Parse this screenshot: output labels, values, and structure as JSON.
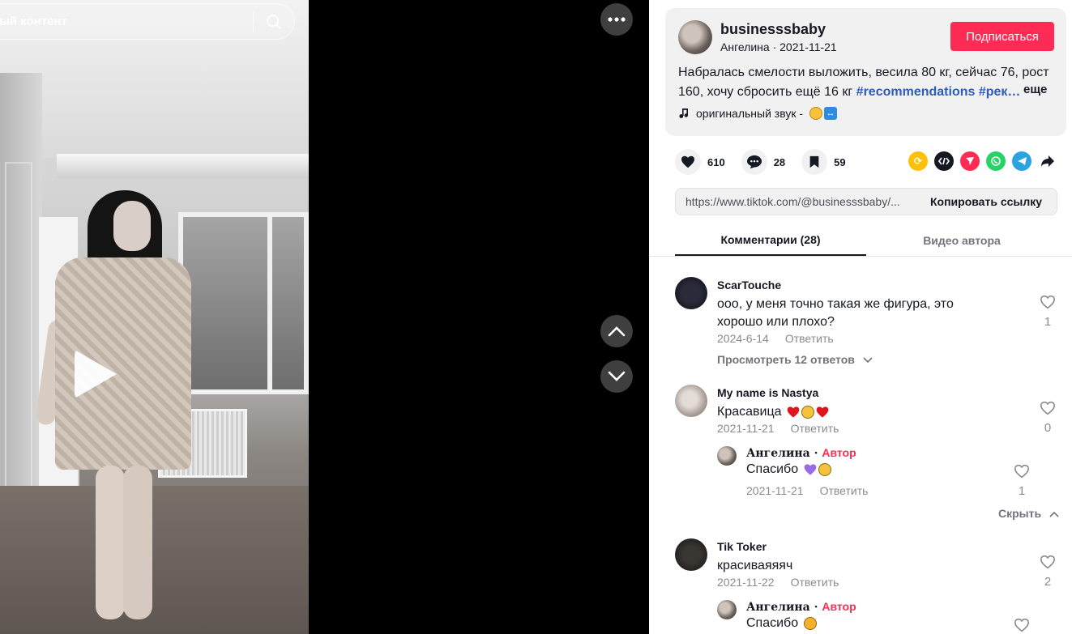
{
  "search": {
    "text": "ый контент"
  },
  "video": {
    "paused": true
  },
  "author": {
    "username": "businesssbaby",
    "subtitle": "Ангелина · 2021-11-21",
    "follow_label": "Подписаться"
  },
  "description": {
    "text": "Набралась смелости выложить, весила 80 кг, сейчас 76, рост 160, хочу сбросить ещё 16 кг ",
    "tags": "#recommendations #рек…",
    "more": "еще"
  },
  "sound": {
    "label": "оригинальный звук -"
  },
  "actions": {
    "likes": "610",
    "comments": "28",
    "saves": "59"
  },
  "share": {
    "url": "https://www.tiktok.com/@businesssbaby/...",
    "copy_label": "Копировать ссылку"
  },
  "tabs": {
    "comments": "Комментарии (28)",
    "videos": "Видео автора"
  },
  "comments": [
    {
      "user": "ScarTouche",
      "text": "ооо, у меня точно такая же фигура, это хорошо или плохо?",
      "date": "2024-6-14",
      "reply": "Ответить",
      "likes": "1",
      "view_replies": "Просмотреть 12 ответов"
    },
    {
      "user": "My name is Nastya",
      "text": "Красавица",
      "date": "2021-11-21",
      "reply": "Ответить",
      "likes": "0",
      "replies": [
        {
          "user": "Ангелина · ",
          "badge": "Автор",
          "text": "Спасибо",
          "date": "2021-11-21",
          "reply": "Ответить",
          "likes": "1"
        }
      ],
      "hide": "Скрыть"
    },
    {
      "user": "Tik Toker",
      "text": "красиваяяяч",
      "date": "2021-11-22",
      "reply": "Ответить",
      "likes": "2",
      "replies": [
        {
          "user": "Ангелина · ",
          "badge": "Автор",
          "text": "Спасибо"
        }
      ]
    }
  ],
  "colors": {
    "accent": "#fe2c55",
    "hashtag": "#2b5db9",
    "muted": "#8a8b91",
    "panel": "#f1f1f2"
  },
  "icons": [
    "search-icon",
    "more-icon",
    "chevron-up-icon",
    "chevron-down-icon",
    "play-icon",
    "heart-icon",
    "comment-icon",
    "bookmark-icon",
    "music-note-icon",
    "repost-icon",
    "embed-icon",
    "send-icon",
    "whatsapp-icon",
    "telegram-icon",
    "share-arrow-icon"
  ]
}
